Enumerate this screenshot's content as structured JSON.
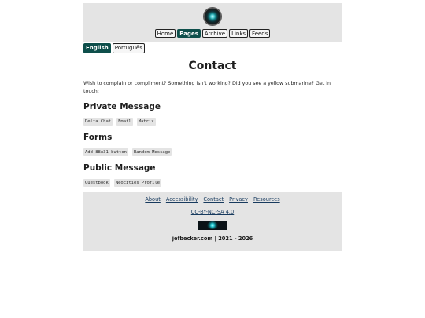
{
  "header": {
    "nav": [
      "Home",
      "Pages",
      "Archive",
      "Links",
      "Feeds"
    ],
    "active_nav": "Pages"
  },
  "language": {
    "english": "English",
    "portuguese": "Português",
    "active": "English"
  },
  "main": {
    "title": "Contact",
    "intro": "Wish to complain or compliment? Something isn't working? Did you see a yellow submarine? Get in touch:",
    "sections": [
      {
        "heading": "Private Message",
        "chips": [
          "Delta Chat",
          "Email",
          "Matrix"
        ]
      },
      {
        "heading": "Forms",
        "chips": [
          "Add 88x31 button",
          "Random Message"
        ]
      },
      {
        "heading": "Public Message",
        "chips": [
          "Guestbook",
          "Neocities Profile"
        ]
      }
    ]
  },
  "footer": {
    "links": [
      "About",
      "Accessibility",
      "Contact",
      "Privacy",
      "Resources"
    ],
    "license": "CC-BY-NC-SA 4.0",
    "copyright": "jefbecker.com | 2021 - 2026"
  },
  "colors": {
    "accent": "#0e4f4b",
    "panel": "#e4e4e4",
    "link": "#173a5e"
  }
}
